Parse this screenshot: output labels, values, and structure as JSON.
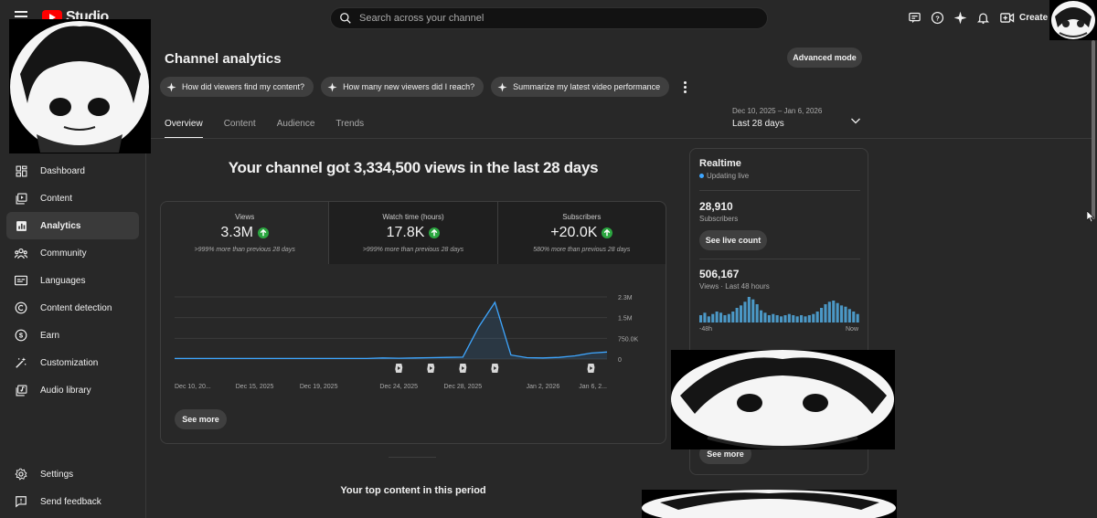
{
  "topbar": {
    "studio_label": "Studio",
    "search_placeholder": "Search across your channel",
    "create_label": "Create"
  },
  "sidebar": {
    "items": [
      {
        "label": "Dashboard",
        "icon": "dashboard-icon"
      },
      {
        "label": "Content",
        "icon": "content-icon"
      },
      {
        "label": "Analytics",
        "icon": "analytics-icon",
        "active": true
      },
      {
        "label": "Community",
        "icon": "community-icon"
      },
      {
        "label": "Languages",
        "icon": "languages-icon"
      },
      {
        "label": "Content detection",
        "icon": "copyright-icon"
      },
      {
        "label": "Earn",
        "icon": "dollar-icon"
      },
      {
        "label": "Customization",
        "icon": "magic-wand-icon"
      },
      {
        "label": "Audio library",
        "icon": "audio-library-icon"
      }
    ],
    "bottom": [
      {
        "label": "Settings",
        "icon": "gear-icon"
      },
      {
        "label": "Send feedback",
        "icon": "feedback-icon"
      }
    ]
  },
  "header": {
    "title": "Channel analytics",
    "advanced_mode": "Advanced mode",
    "chips": [
      "How did viewers find my content?",
      "How many new viewers did I reach?",
      "Summarize my latest video performance"
    ]
  },
  "tabs": [
    "Overview",
    "Content",
    "Audience",
    "Trends"
  ],
  "period": {
    "range": "Dec 10, 2025 – Jan 6, 2026",
    "label": "Last 28 days"
  },
  "headline": "Your channel got 3,334,500 views in the last 28 days",
  "metrics": [
    {
      "label": "Views",
      "value": "3.3M",
      "sub": ">999% more than previous 28 days"
    },
    {
      "label": "Watch time (hours)",
      "value": "17.8K",
      "sub": ">999% more than previous 28 days"
    },
    {
      "label": "Subscribers",
      "value": "+20.0K",
      "sub": "580% more than previous 28 days"
    }
  ],
  "chart_data": {
    "type": "area",
    "series": [
      {
        "values": [
          0.02,
          0.02,
          0.02,
          0.02,
          0.02,
          0.02,
          0.02,
          0.02,
          0.02,
          0.02,
          0.02,
          0.02,
          0.02,
          0.04,
          0.03,
          0.04,
          0.05,
          0.06,
          0.07,
          1.2,
          2.1,
          0.15,
          0.05,
          0.04,
          0.06,
          0.12,
          0.22,
          0.26
        ]
      }
    ],
    "x_labels": [
      "Dec 10, 20...",
      "Dec 15, 2025",
      "Dec 19, 2025",
      "Dec 24, 2025",
      "Dec 28, 2025",
      "Jan 2, 2026",
      "Jan 6, 2..."
    ],
    "y_ticks": [
      "2.3M",
      "1.5M",
      "750.0K",
      "0"
    ],
    "ylim": [
      0,
      2.3
    ],
    "grid": true,
    "accent": "#3ea6ff",
    "upload_markers_at": [
      14,
      16,
      18,
      20,
      26
    ]
  },
  "main": {
    "see_more": "See more",
    "top_content_title": "Your top content in this period"
  },
  "realtime": {
    "title": "Realtime",
    "live_label": "Updating live",
    "subscribers_value": "28,910",
    "subscribers_label": "Subscribers",
    "see_live_count": "See live count",
    "views_value": "506,167",
    "views_label": "Views · Last 48 hours",
    "axis_left": "-48h",
    "axis_right": "Now",
    "see_more": "See more",
    "bars": [
      6,
      8,
      5,
      7,
      9,
      8,
      6,
      7,
      9,
      12,
      14,
      17,
      21,
      19,
      15,
      10,
      8,
      6,
      7,
      6,
      5,
      6,
      7,
      6,
      5,
      6,
      5,
      6,
      7,
      9,
      12,
      15,
      17,
      18,
      16,
      14,
      13,
      11,
      9,
      7
    ]
  },
  "colors": {
    "background": "#282828",
    "accent": "#3ea6ff",
    "positive": "#2ba640",
    "brand_red": "#ff0000"
  }
}
